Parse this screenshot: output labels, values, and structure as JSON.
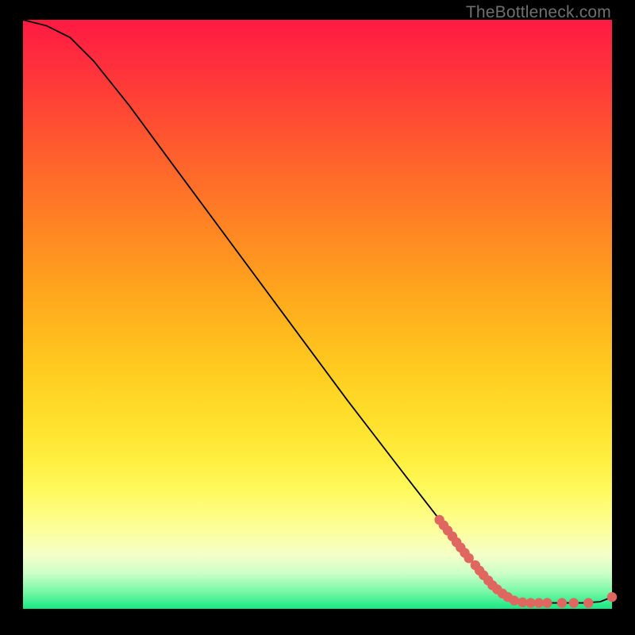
{
  "watermark": "TheBottleneck.com",
  "chart_data": {
    "type": "line",
    "title": "",
    "xlabel": "",
    "ylabel": "",
    "xlim": [
      0,
      100
    ],
    "ylim": [
      0,
      100
    ],
    "curve": [
      {
        "x": 0,
        "y": 100
      },
      {
        "x": 4,
        "y": 99
      },
      {
        "x": 8,
        "y": 97
      },
      {
        "x": 12,
        "y": 93
      },
      {
        "x": 18,
        "y": 85.5
      },
      {
        "x": 25,
        "y": 76
      },
      {
        "x": 35,
        "y": 62.5
      },
      {
        "x": 45,
        "y": 49
      },
      {
        "x": 55,
        "y": 35.5
      },
      {
        "x": 65,
        "y": 22.5
      },
      {
        "x": 72,
        "y": 13.5
      },
      {
        "x": 78,
        "y": 6
      },
      {
        "x": 82,
        "y": 2.2
      },
      {
        "x": 85,
        "y": 1.1
      },
      {
        "x": 90,
        "y": 1.0
      },
      {
        "x": 95,
        "y": 1.0
      },
      {
        "x": 98,
        "y": 1.2
      },
      {
        "x": 100,
        "y": 2.0
      }
    ],
    "points": [
      {
        "x": 70.7,
        "y": 15.1
      },
      {
        "x": 71.4,
        "y": 14.2
      },
      {
        "x": 72.1,
        "y": 13.3
      },
      {
        "x": 72.9,
        "y": 12.3
      },
      {
        "x": 73.6,
        "y": 11.3
      },
      {
        "x": 74.3,
        "y": 10.4
      },
      {
        "x": 75.0,
        "y": 9.5
      },
      {
        "x": 75.7,
        "y": 8.6
      },
      {
        "x": 76.8,
        "y": 7.4
      },
      {
        "x": 77.5,
        "y": 6.5
      },
      {
        "x": 78.2,
        "y": 5.7
      },
      {
        "x": 79.0,
        "y": 4.8
      },
      {
        "x": 79.7,
        "y": 4.0
      },
      {
        "x": 80.5,
        "y": 3.3
      },
      {
        "x": 81.4,
        "y": 2.6
      },
      {
        "x": 82.3,
        "y": 2.0
      },
      {
        "x": 83.4,
        "y": 1.4
      },
      {
        "x": 84.8,
        "y": 1.1
      },
      {
        "x": 86.2,
        "y": 1.0
      },
      {
        "x": 87.6,
        "y": 1.0
      },
      {
        "x": 89.0,
        "y": 1.0
      },
      {
        "x": 91.5,
        "y": 1.0
      },
      {
        "x": 93.5,
        "y": 1.0
      },
      {
        "x": 96.0,
        "y": 1.0
      },
      {
        "x": 100.0,
        "y": 2.0
      }
    ],
    "point_color": "#e0675f",
    "point_radius": 6.2,
    "line_color": "#000000",
    "line_width": 1.8
  }
}
